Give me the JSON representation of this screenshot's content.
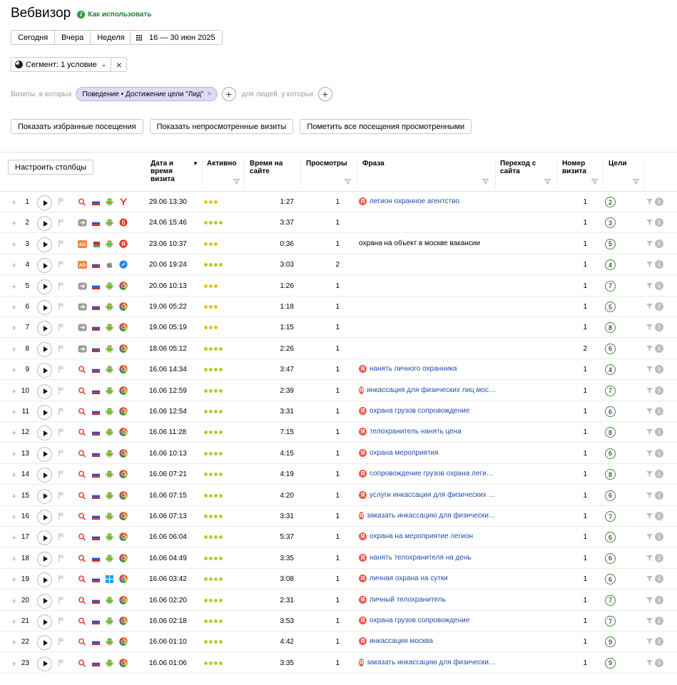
{
  "header": {
    "title": "Вебвизор",
    "howto": "Как использовать"
  },
  "period": {
    "today": "Сегодня",
    "yesterday": "Вчера",
    "week": "Неделя",
    "range": "16 — 30 июн 2025"
  },
  "segment": {
    "label": "Сегмент: 1 условие"
  },
  "filters": {
    "visits_label": "Визиты, в которых",
    "chip": "Поведение • Достижение цели \"Лид\"",
    "people_label": "для людей, у которых"
  },
  "actions": {
    "favorites": "Показать избранные посещения",
    "unviewed": "Показать непросмотренные визиты",
    "mark_all": "Пометить все посещения просмотренными"
  },
  "table": {
    "configure": "Настроить столбцы",
    "headers": {
      "date": "Дата и\nвремя\nвизита",
      "activity": "Активно",
      "time": "Время на\nсайте",
      "views": "Просмотры",
      "phrase": "Фраза",
      "referrer": "Переход с\nсайта",
      "visit_no": "Номер\nвизита",
      "goals": "Цели"
    },
    "rows": [
      {
        "n": "1",
        "src": "search",
        "country": "ru",
        "os": "android",
        "browser": "yandex",
        "date": "29.06 13:30",
        "act": 3,
        "time": "1:27",
        "views": "1",
        "phrase": "легион охранное агентство",
        "ya": true,
        "visit": "1",
        "goals": "2"
      },
      {
        "n": "2",
        "src": "direct",
        "country": "ru",
        "os": "android",
        "browser": "opera",
        "date": "24.06 15:46",
        "act": 4,
        "time": "3:37",
        "views": "1",
        "phrase": "",
        "ya": false,
        "visit": "1",
        "goals": "3"
      },
      {
        "n": "3",
        "src": "ad",
        "country": "by",
        "os": "android",
        "browser": "yabrowser",
        "date": "23.06 10:37",
        "act": 3,
        "time": "0:36",
        "views": "1",
        "phrase": "охрана на объект в москве вакансии",
        "ya": false,
        "visit": "1",
        "goals": "5"
      },
      {
        "n": "4",
        "src": "ad",
        "country": "ru",
        "os": "apple",
        "browser": "safari",
        "date": "20.06 19:24",
        "act": 4,
        "time": "3:03",
        "views": "2",
        "phrase": "",
        "ya": false,
        "visit": "1",
        "goals": "4"
      },
      {
        "n": "5",
        "src": "direct",
        "country": "ru",
        "os": "android",
        "browser": "chrome",
        "date": "20.06 10:13",
        "act": 3,
        "time": "1:26",
        "views": "1",
        "phrase": "",
        "ya": false,
        "visit": "1",
        "goals": "7"
      },
      {
        "n": "6",
        "src": "direct",
        "country": "ru",
        "os": "android",
        "browser": "chrome",
        "date": "19.06 05:22",
        "act": 3,
        "time": "1:18",
        "views": "1",
        "phrase": "",
        "ya": false,
        "visit": "1",
        "goals": "5"
      },
      {
        "n": "7",
        "src": "direct",
        "country": "ru",
        "os": "android",
        "browser": "chrome",
        "date": "19.06 05:19",
        "act": 3,
        "time": "1:15",
        "views": "1",
        "phrase": "",
        "ya": false,
        "visit": "1",
        "goals": "8"
      },
      {
        "n": "8",
        "src": "direct",
        "country": "ru",
        "os": "android",
        "browser": "chrome",
        "date": "18.06 05:12",
        "act": 4,
        "time": "2:26",
        "views": "1",
        "phrase": "",
        "ya": false,
        "visit": "2",
        "goals": "6"
      },
      {
        "n": "9",
        "src": "search",
        "country": "ru",
        "os": "android",
        "browser": "chrome",
        "date": "16.06 14:34",
        "act": 4,
        "time": "3:47",
        "views": "1",
        "phrase": "нанять личного охранника",
        "ya": true,
        "visit": "1",
        "goals": "4"
      },
      {
        "n": "10",
        "src": "search",
        "country": "ru",
        "os": "android",
        "browser": "chrome",
        "date": "16.06 12:59",
        "act": 4,
        "time": "2:39",
        "views": "1",
        "phrase": "инкассация для физических лиц мос…",
        "ya": true,
        "visit": "1",
        "goals": "7"
      },
      {
        "n": "11",
        "src": "search",
        "country": "ru",
        "os": "android",
        "browser": "chrome",
        "date": "16.06 12:54",
        "act": 4,
        "time": "3:31",
        "views": "1",
        "phrase": "охрана грузов сопровождение",
        "ya": true,
        "visit": "1",
        "goals": "6"
      },
      {
        "n": "12",
        "src": "search",
        "country": "ru",
        "os": "android",
        "browser": "chrome",
        "date": "16.06 11:28",
        "act": 4,
        "time": "7:15",
        "views": "1",
        "phrase": "телохранитель нанять цена",
        "ya": true,
        "visit": "1",
        "goals": "8"
      },
      {
        "n": "13",
        "src": "search",
        "country": "ru",
        "os": "android",
        "browser": "chrome",
        "date": "16.06 10:13",
        "act": 4,
        "time": "4:15",
        "views": "1",
        "phrase": "охрана мероприятия",
        "ya": true,
        "visit": "1",
        "goals": "6"
      },
      {
        "n": "14",
        "src": "search",
        "country": "ru",
        "os": "android",
        "browser": "chrome",
        "date": "16.06 07:21",
        "act": 4,
        "time": "4:19",
        "views": "1",
        "phrase": "сопровождение грузов охрана леги…",
        "ya": true,
        "visit": "1",
        "goals": "8"
      },
      {
        "n": "15",
        "src": "search",
        "country": "ru",
        "os": "android",
        "browser": "chrome",
        "date": "16.06 07:15",
        "act": 4,
        "time": "4:20",
        "views": "1",
        "phrase": "услуги инкассации для физических …",
        "ya": true,
        "visit": "1",
        "goals": "6"
      },
      {
        "n": "16",
        "src": "search",
        "country": "ru",
        "os": "android",
        "browser": "chrome",
        "date": "16.06 07:13",
        "act": 4,
        "time": "3:31",
        "views": "1",
        "phrase": "заказать инкассацию для физически…",
        "ya": true,
        "visit": "1",
        "goals": "7"
      },
      {
        "n": "17",
        "src": "search",
        "country": "ru",
        "os": "android",
        "browser": "chrome",
        "date": "16.06 06:04",
        "act": 4,
        "time": "5:37",
        "views": "1",
        "phrase": "охрана на мероприятие легион",
        "ya": true,
        "visit": "1",
        "goals": "6"
      },
      {
        "n": "18",
        "src": "search",
        "country": "ru",
        "os": "android",
        "browser": "chrome",
        "date": "16.06 04:49",
        "act": 4,
        "time": "3:35",
        "views": "1",
        "phrase": "нанять телохранителя на день",
        "ya": true,
        "visit": "1",
        "goals": "6"
      },
      {
        "n": "19",
        "src": "search",
        "country": "ru",
        "os": "windows",
        "browser": "chrome",
        "date": "16.06 03:42",
        "act": 4,
        "time": "3:08",
        "views": "1",
        "phrase": "личная охрана на сутки",
        "ya": true,
        "visit": "1",
        "goals": "6"
      },
      {
        "n": "20",
        "src": "search",
        "country": "ru",
        "os": "android",
        "browser": "chrome",
        "date": "16.06 02:20",
        "act": 4,
        "time": "2:31",
        "views": "1",
        "phrase": "личный телохранитель",
        "ya": true,
        "visit": "1",
        "goals": "7"
      },
      {
        "n": "21",
        "src": "search",
        "country": "ru",
        "os": "android",
        "browser": "chrome",
        "date": "16.06 02:18",
        "act": 4,
        "time": "3:53",
        "views": "1",
        "phrase": "охрана грузов сопровождение",
        "ya": true,
        "visit": "1",
        "goals": "7"
      },
      {
        "n": "22",
        "src": "search",
        "country": "ru",
        "os": "android",
        "browser": "chrome",
        "date": "16.06 01:10",
        "act": 4,
        "time": "4:42",
        "views": "1",
        "phrase": "инкассация москва",
        "ya": true,
        "visit": "1",
        "goals": "9"
      },
      {
        "n": "23",
        "src": "search",
        "country": "ru",
        "os": "android",
        "browser": "chrome",
        "date": "16.06 01:06",
        "act": 4,
        "time": "3:35",
        "views": "1",
        "phrase": "заказать инкассацию для физически…",
        "ya": true,
        "visit": "1",
        "goals": "9"
      }
    ]
  },
  "colors": {
    "activity_3": "#e6c21a",
    "activity_4": "#b5cc2e",
    "goal_border": "#3a8f2e",
    "link": "#1f4fa8",
    "yandex_red": "#e65a4e",
    "chip_bg": "#dcdcf5"
  }
}
